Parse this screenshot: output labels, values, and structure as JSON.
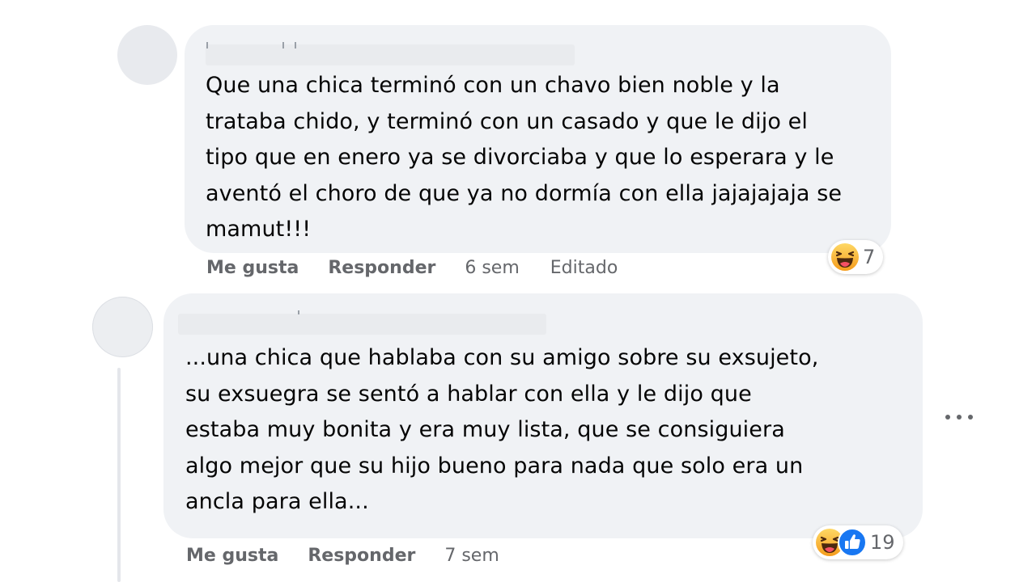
{
  "comments": [
    {
      "text": "Que una chica terminó con un chavo bien noble y la\ntrataba chido, y terminó con un casado y que le dijo el\ntipo que en enero ya se divorciaba y que lo esperara y le\naventó el choro de que ya no dormía con ella jajajajaja se\nmamut!!!",
      "actions": {
        "like": "Me gusta",
        "reply": "Responder",
        "time": "6 sem",
        "edited": "Editado"
      },
      "reactions": {
        "icons": [
          "haha-icon"
        ],
        "count": "7"
      }
    },
    {
      "text": "...una chica que hablaba con su amigo sobre su exsujeto,\nsu exsuegra se sentó a hablar con ella y le dijo que\nestaba muy bonita y era muy lista, que se consiguiera\nalgo mejor que su hijo bueno para nada que solo era un\nancla para ella...",
      "actions": {
        "like": "Me gusta",
        "reply": "Responder",
        "time": "7 sem"
      },
      "reactions": {
        "icons": [
          "haha-icon",
          "like-icon"
        ],
        "count": "19"
      }
    }
  ],
  "colors": {
    "bubble": "#f0f2f5",
    "meta_text": "#65676b",
    "like_blue": "#1877f2",
    "haha_yellow": "#f7b125"
  }
}
